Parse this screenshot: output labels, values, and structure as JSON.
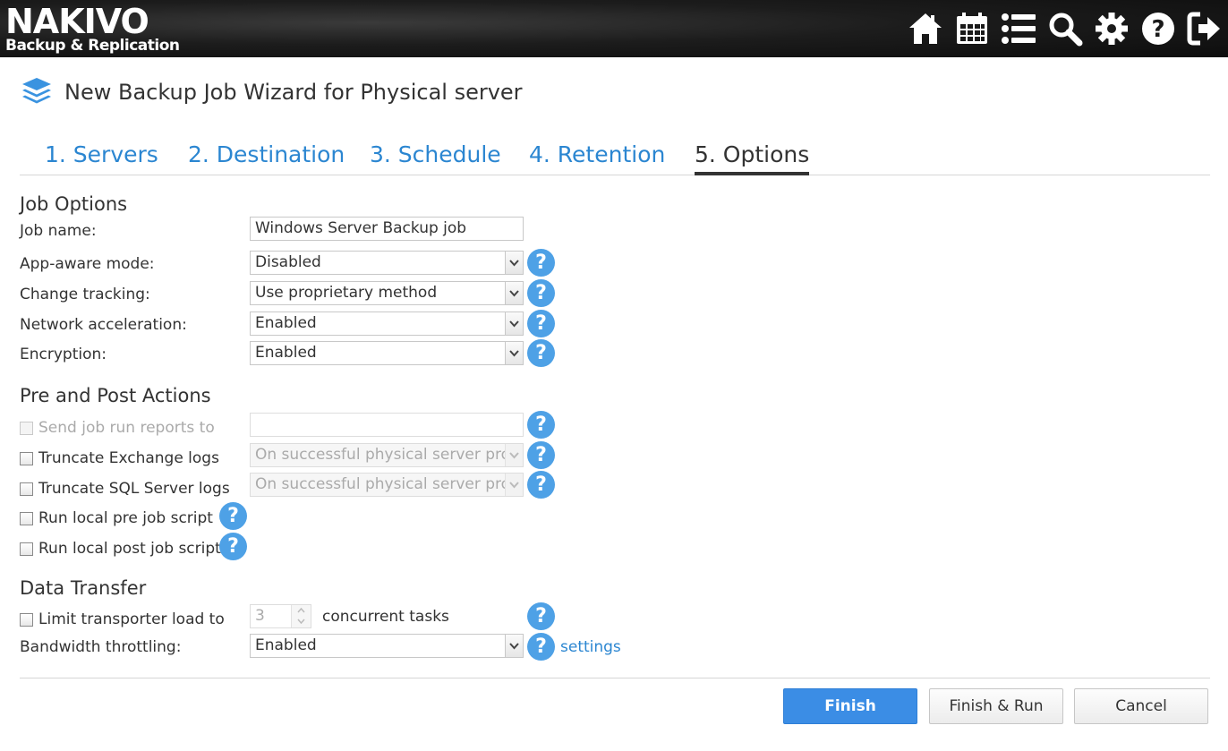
{
  "header": {
    "logo_main": "NAKIVO",
    "logo_sub": "Backup & Replication",
    "icons": [
      "home-icon",
      "calendar-icon",
      "list-icon",
      "search-icon",
      "gear-icon",
      "help-icon",
      "logout-icon"
    ]
  },
  "wizard": {
    "title": "New Backup Job Wizard for Physical server",
    "icon": "stack-layers-icon"
  },
  "tabs": [
    {
      "label": "1. Servers",
      "active": false
    },
    {
      "label": "2. Destination",
      "active": false
    },
    {
      "label": "3. Schedule",
      "active": false
    },
    {
      "label": "4. Retention",
      "active": false
    },
    {
      "label": "5. Options",
      "active": true
    }
  ],
  "job_options": {
    "title": "Job Options",
    "job_name_label": "Job name:",
    "job_name_value": "Windows Server Backup job",
    "app_aware_label": "App-aware mode:",
    "app_aware_value": "Disabled",
    "change_tracking_label": "Change tracking:",
    "change_tracking_value": "Use proprietary method",
    "network_accel_label": "Network acceleration:",
    "network_accel_value": "Enabled",
    "encryption_label": "Encryption:",
    "encryption_value": "Enabled"
  },
  "pre_post": {
    "title": "Pre and Post Actions",
    "send_reports_label": "Send job run reports to",
    "send_reports_value": "",
    "truncate_exchange_label": "Truncate Exchange logs",
    "truncate_exchange_value": "On successful physical server proce",
    "truncate_sql_label": "Truncate SQL Server logs",
    "truncate_sql_value": "On successful physical server proce",
    "pre_script_label": "Run local pre job script",
    "post_script_label": "Run local post job script"
  },
  "data_transfer": {
    "title": "Data Transfer",
    "limit_label": "Limit transporter load to",
    "limit_value": "3",
    "concurrent_label": "concurrent tasks",
    "bandwidth_label": "Bandwidth throttling:",
    "bandwidth_value": "Enabled",
    "settings_link": "settings"
  },
  "help_glyph": "?",
  "buttons": {
    "finish": "Finish",
    "finish_run": "Finish & Run",
    "cancel": "Cancel"
  },
  "colors": {
    "accent": "#2b86d1",
    "help": "#4ea1e6",
    "primary_button": "#3b8de5"
  }
}
